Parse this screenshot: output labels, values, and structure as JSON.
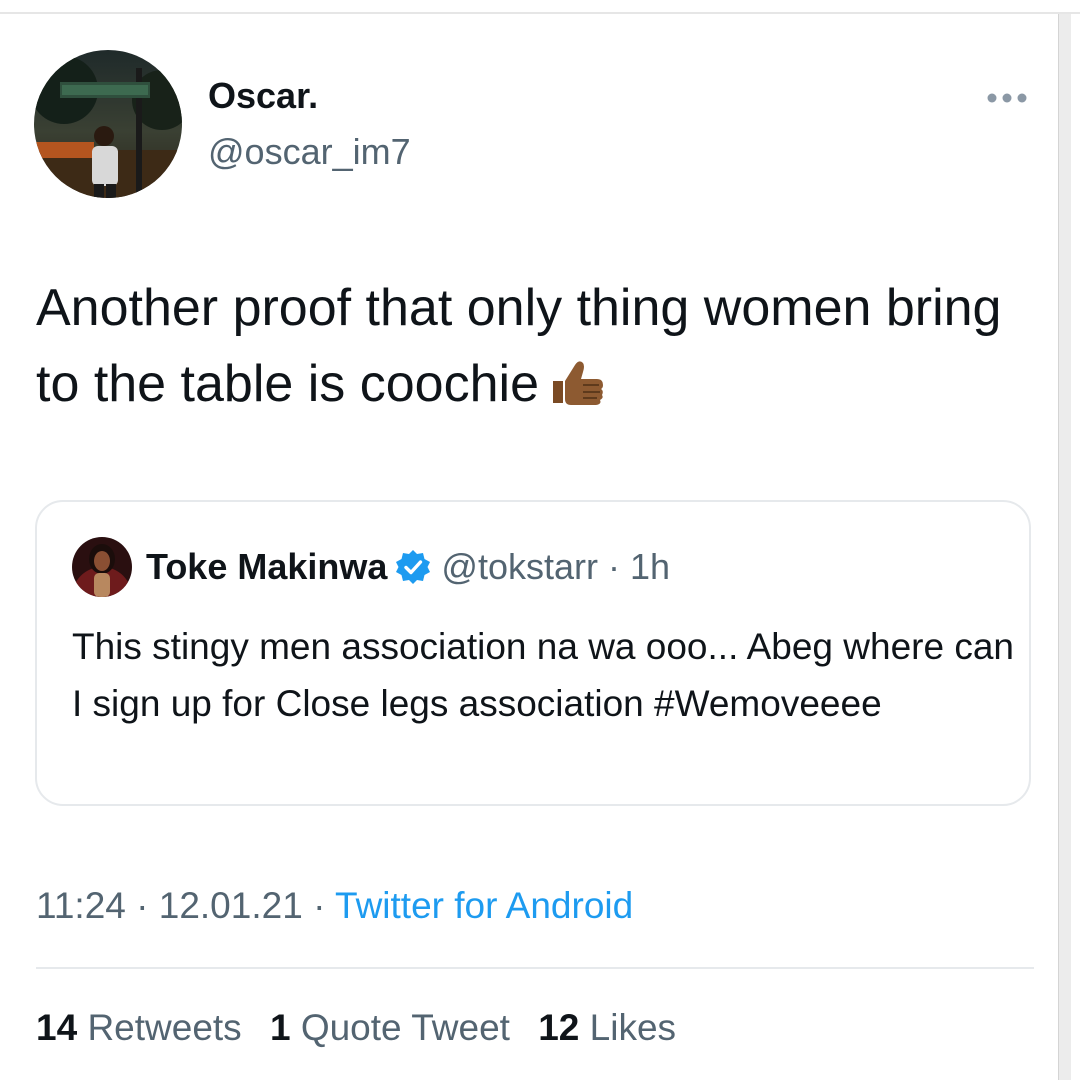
{
  "author": {
    "display_name": "Oscar.",
    "handle": "@oscar_im7"
  },
  "tweet": {
    "text": "Another proof that only thing women bring to the table is coochie",
    "emoji": "thumbs-up-medium-dark-skin-tone"
  },
  "quoted_tweet": {
    "display_name": "Toke Makinwa",
    "verified": true,
    "handle": "@tokstarr",
    "separator": "·",
    "time": "1h",
    "text": "This stingy men association na wa ooo... Abeg where can I sign up for Close legs association #Wemoveeee"
  },
  "meta": {
    "time": "11:24",
    "sep1": "·",
    "date": "12.01.21",
    "sep2": "·",
    "source": "Twitter for Android"
  },
  "stats": {
    "retweets_count": "14",
    "retweets_label": "Retweets",
    "quotes_count": "1",
    "quotes_label": "Quote Tweet",
    "likes_count": "12",
    "likes_label": "Likes"
  },
  "colors": {
    "text": "#0f1419",
    "secondary": "#536471",
    "accent": "#1d9bf0",
    "border": "#e6e9ec"
  }
}
